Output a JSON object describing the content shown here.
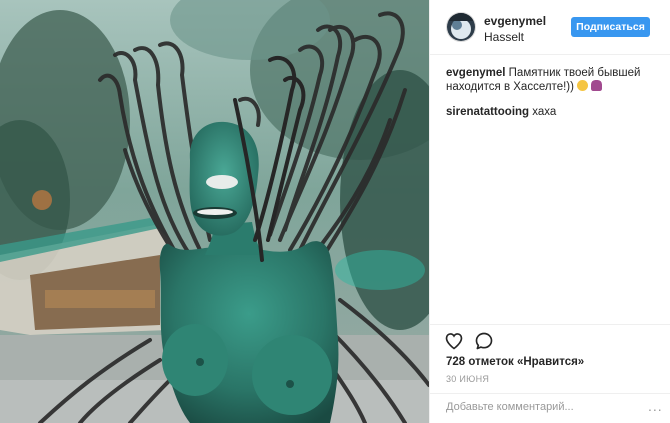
{
  "post": {
    "username": "evgenymel",
    "location": "Hasselt",
    "follow_label": "Подписаться"
  },
  "comments": [
    {
      "username": "evgenymel",
      "text": "Памятник твоей бывшей находится в Хасселте!))"
    },
    {
      "username": "sirenatattooing",
      "text": "хаха"
    }
  ],
  "actions": {
    "like_icon": "heart-icon",
    "comment_icon": "comment-icon"
  },
  "stats": {
    "likes": "728 отметок «Нравится»",
    "date": "30 ИЮНЯ"
  },
  "comment_box": {
    "placeholder": "Добавьте комментарий...",
    "more": "..."
  },
  "colors": {
    "accent": "#3897f0",
    "statue": "#2e7a6c",
    "wire": "#2b2b2b"
  }
}
